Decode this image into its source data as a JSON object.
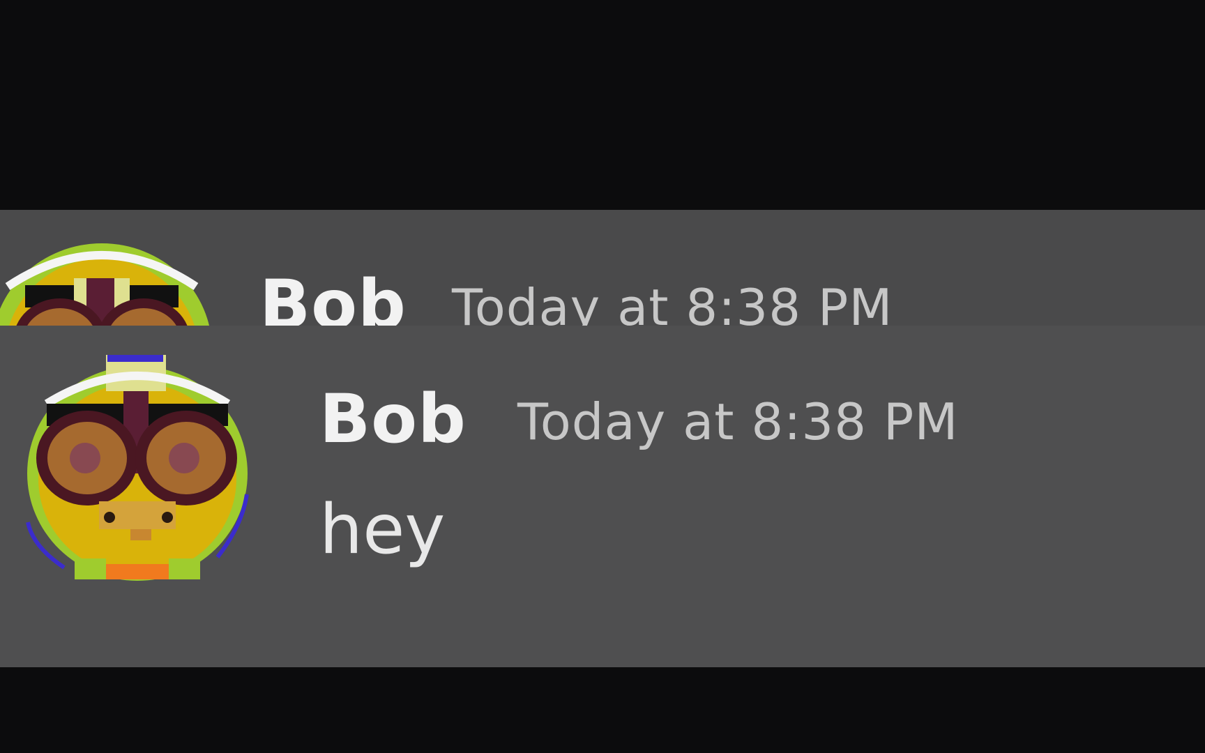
{
  "messages": [
    {
      "author": "Bob",
      "timestamp": "Today at 8:38 PM",
      "avatar": "nerd-face-avatar"
    },
    {
      "author": "Bob",
      "timestamp": "Today at 8:38 PM",
      "text": "hey",
      "avatar": "nerd-face-avatar"
    }
  ],
  "colors": {
    "page_background": "#0c0c0d",
    "message_background": "#4f4f50",
    "author_text": "#f2f2f2",
    "timestamp_text": "#c7c7c7"
  }
}
